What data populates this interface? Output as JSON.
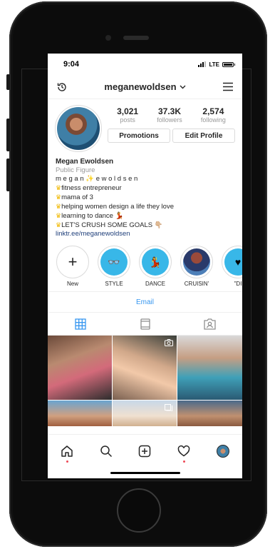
{
  "status": {
    "time": "9:04",
    "network": "LTE"
  },
  "topbar": {
    "username": "meganewoldsen",
    "history_icon": "history-icon",
    "menu_icon": "hamburger-icon"
  },
  "profile": {
    "stats": [
      {
        "value": "3,021",
        "label": "posts"
      },
      {
        "value": "37.3K",
        "label": "followers"
      },
      {
        "value": "2,574",
        "label": "following"
      }
    ],
    "promotions_label": "Promotions",
    "edit_label": "Edit Profile"
  },
  "bio": {
    "name": "Megan Ewoldsen",
    "category": "Public Figure",
    "lines": [
      "m e g a n ✨ e w o l d s e n",
      "fitness entrepreneur",
      "mama of 3",
      "helping women design a life they love",
      "learning to dance 💃",
      "LET'S CRUSH SOME GOALS 👇🏼"
    ],
    "link": "linktr.ee/meganewoldsen"
  },
  "highlights": [
    {
      "label": "New",
      "icon": "plus-icon",
      "glyph": "+"
    },
    {
      "label": "STYLE",
      "icon": "sunglasses-icon",
      "glyph": "👓"
    },
    {
      "label": "DANCE",
      "icon": "dancer-icon",
      "glyph": "💃"
    },
    {
      "label": "CRUISIN'",
      "icon": "photo-icon",
      "glyph": ""
    },
    {
      "label": "\"DI",
      "icon": "heart-hand-icon",
      "glyph": "♥"
    }
  ],
  "contact": {
    "email_label": "Email"
  },
  "tabs": {
    "grid_icon": "grid-icon",
    "igtv_icon": "igtv-icon",
    "tagged_icon": "tagged-icon"
  },
  "colors": {
    "link_blue": "#3897f0",
    "highlight_blue": "#38b7e8",
    "notification_red": "#ed4956"
  }
}
